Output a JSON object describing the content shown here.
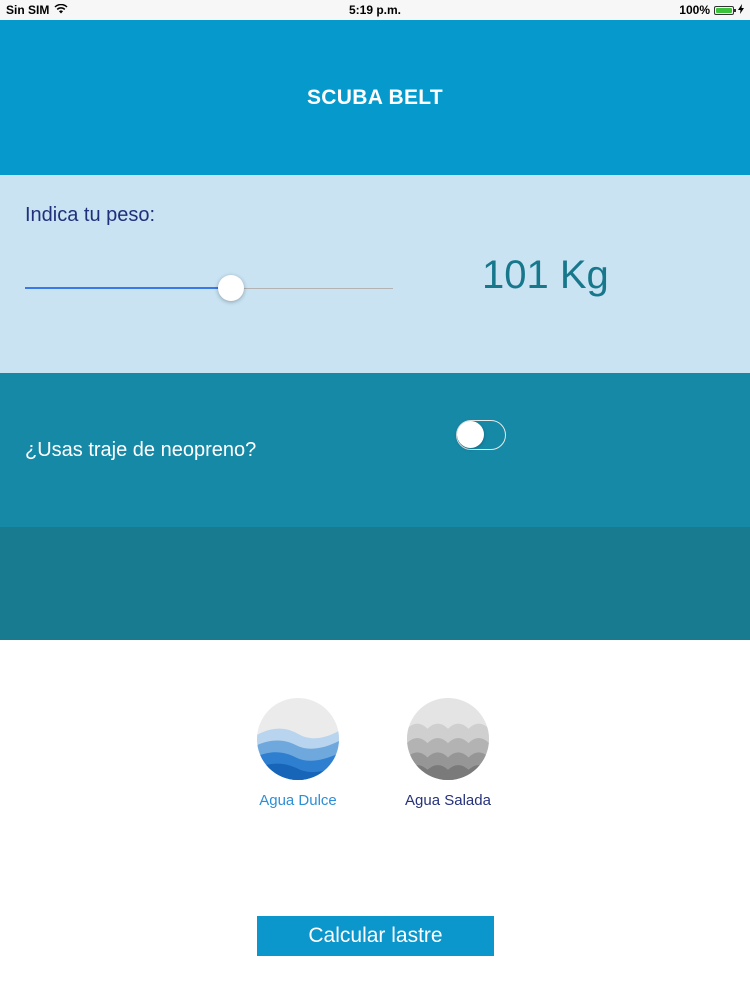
{
  "status_bar": {
    "carrier": "Sin SIM",
    "time": "5:19 p.m.",
    "battery": "100%"
  },
  "header": {
    "title": "SCUBA BELT",
    "color": "#0599cc"
  },
  "weight": {
    "label": "Indica tu peso:",
    "value_text": "101 Kg",
    "slider_fraction": 0.56
  },
  "neoprene": {
    "label": "¿Usas traje de neopreno?",
    "enabled": false
  },
  "water": {
    "options": [
      {
        "label": "Agua Dulce",
        "icon": "fresh-water-wave-icon",
        "color": "#2d8fd6"
      },
      {
        "label": "Agua Salada",
        "icon": "salt-water-wave-icon",
        "color": "#26327a"
      }
    ]
  },
  "actions": {
    "calculate_label": "Calcular lastre"
  }
}
